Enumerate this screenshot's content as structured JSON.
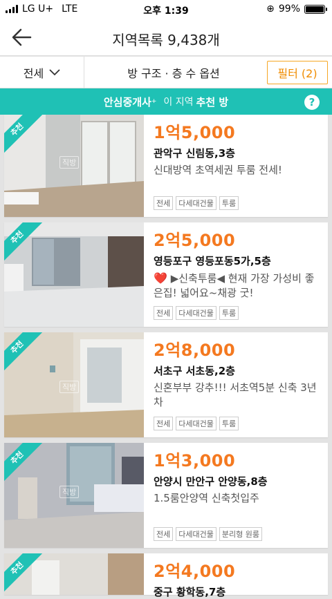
{
  "status": {
    "carrier": "LG U+",
    "network": "LTE",
    "time": "오후 1:39",
    "battery": "99%",
    "battery_fraction": 0.99
  },
  "header": {
    "title": "지역목록 9,438개"
  },
  "filters": {
    "deal_type": "전세",
    "options": "방 구조 · 층 수 옵션",
    "filter_label": "필터 (2)"
  },
  "banner": {
    "brand": "안심중개사",
    "brand_sup": "+",
    "text": "이 지역",
    "highlight": "추천 방"
  },
  "watermark": "직방",
  "listings": [
    {
      "badge": "추천",
      "price": "1억5,000",
      "location": "관악구 신림동,3층",
      "desc": "신대방역 초역세권 투룸 전세!",
      "tags": [
        "전세",
        "다세대건물",
        "투룸"
      ]
    },
    {
      "badge": "추천",
      "price": "2억5,000",
      "location": "영등포구 영등포동5가,5층",
      "heart": "❤️",
      "desc": "▶신축투룸◀ 현재 가장 가성비 좋은집! 넓어요~채광 굿!",
      "tags": [
        "전세",
        "다세대건물",
        "투룸"
      ]
    },
    {
      "badge": "추천",
      "price": "2억8,000",
      "location": "서초구 서초동,2층",
      "desc": "신혼부부 강추!!! 서초역5분 신축 3년차",
      "tags": [
        "전세",
        "다세대건물",
        "투룸"
      ]
    },
    {
      "badge": "추천",
      "price": "1억3,000",
      "location": "안양시 만안구 안양동,8층",
      "desc": "1.5룸안양역 신축첫입주",
      "tags": [
        "전세",
        "다세대건물",
        "분리형 원룸"
      ]
    },
    {
      "badge": "추천",
      "price": "2억4,000",
      "location": "중구 황학동,7층",
      "desc": "",
      "tags": []
    }
  ],
  "colors": {
    "accent": "#1fc1b5",
    "price": "#f47920",
    "filter_border": "#f6a623"
  }
}
